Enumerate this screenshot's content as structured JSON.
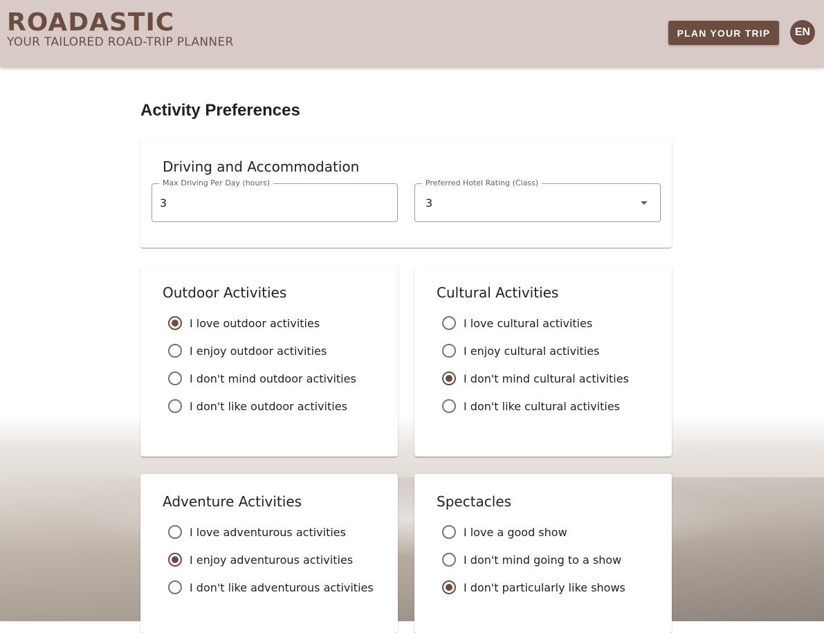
{
  "header": {
    "brand": "ROADASTIC",
    "tagline": "YOUR TAILORED ROAD-TRIP PLANNER",
    "plan_button": "PLAN YOUR TRIP",
    "language": "EN"
  },
  "page": {
    "title": "Activity Preferences"
  },
  "driving": {
    "title": "Driving and Accommodation",
    "max_driving_label": "Max Driving Per Day (hours)",
    "max_driving_value": "3",
    "hotel_rating_label": "Preferred Hotel Rating (Class)",
    "hotel_rating_value": "3"
  },
  "outdoor": {
    "title": "Outdoor Activities",
    "options": [
      {
        "label": "I love outdoor activities",
        "checked": true
      },
      {
        "label": "I enjoy outdoor activities",
        "checked": false
      },
      {
        "label": "I don't mind outdoor activities",
        "checked": false
      },
      {
        "label": "I don't like outdoor activities",
        "checked": false
      }
    ]
  },
  "cultural": {
    "title": "Cultural Activities",
    "options": [
      {
        "label": "I love cultural activities",
        "checked": false
      },
      {
        "label": "I enjoy cultural activities",
        "checked": false
      },
      {
        "label": "I don't mind cultural activities",
        "checked": true
      },
      {
        "label": "I don't like cultural activities",
        "checked": false
      }
    ]
  },
  "adventure": {
    "title": "Adventure Activities",
    "options": [
      {
        "label": "I love adventurous activities",
        "checked": false
      },
      {
        "label": "I enjoy adventurous activities",
        "checked": true
      },
      {
        "label": "I don't like adventurous activities",
        "checked": false
      }
    ]
  },
  "spectacles": {
    "title": "Spectacles",
    "options": [
      {
        "label": "I love a good show",
        "checked": false
      },
      {
        "label": "I don't mind going to a show",
        "checked": false
      },
      {
        "label": "I don't particularly like shows",
        "checked": true
      }
    ]
  },
  "colors": {
    "accent": "#6d4c41",
    "header_bg": "#d8cbc7"
  }
}
